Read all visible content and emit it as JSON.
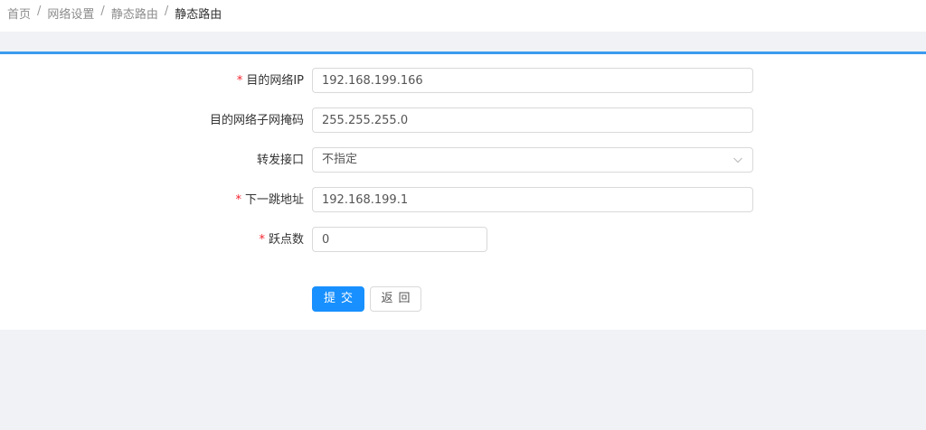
{
  "breadcrumb": {
    "items": [
      "首页",
      "网络设置",
      "静态路由",
      "静态路由"
    ],
    "separator": "/"
  },
  "form": {
    "fields": [
      {
        "label": "目的网络IP",
        "required": true,
        "value": "192.168.199.166"
      },
      {
        "label": "目的网络子网掩码",
        "required": false,
        "value": "255.255.255.0"
      },
      {
        "label": "转发接口",
        "required": false,
        "value": "不指定"
      },
      {
        "label": "下一跳地址",
        "required": true,
        "value": "192.168.199.1"
      },
      {
        "label": "跃点数",
        "required": true,
        "value": "0"
      }
    ],
    "required_mark": "*"
  },
  "buttons": {
    "submit_label": "提交",
    "back_label": "返回"
  },
  "colors": {
    "primary": "#1890ff",
    "accent_border": "#3c9bef",
    "required": "#f5222d",
    "background": "#f0f2f5"
  },
  "icons": {
    "select_arrow": "chevron-down-icon"
  }
}
